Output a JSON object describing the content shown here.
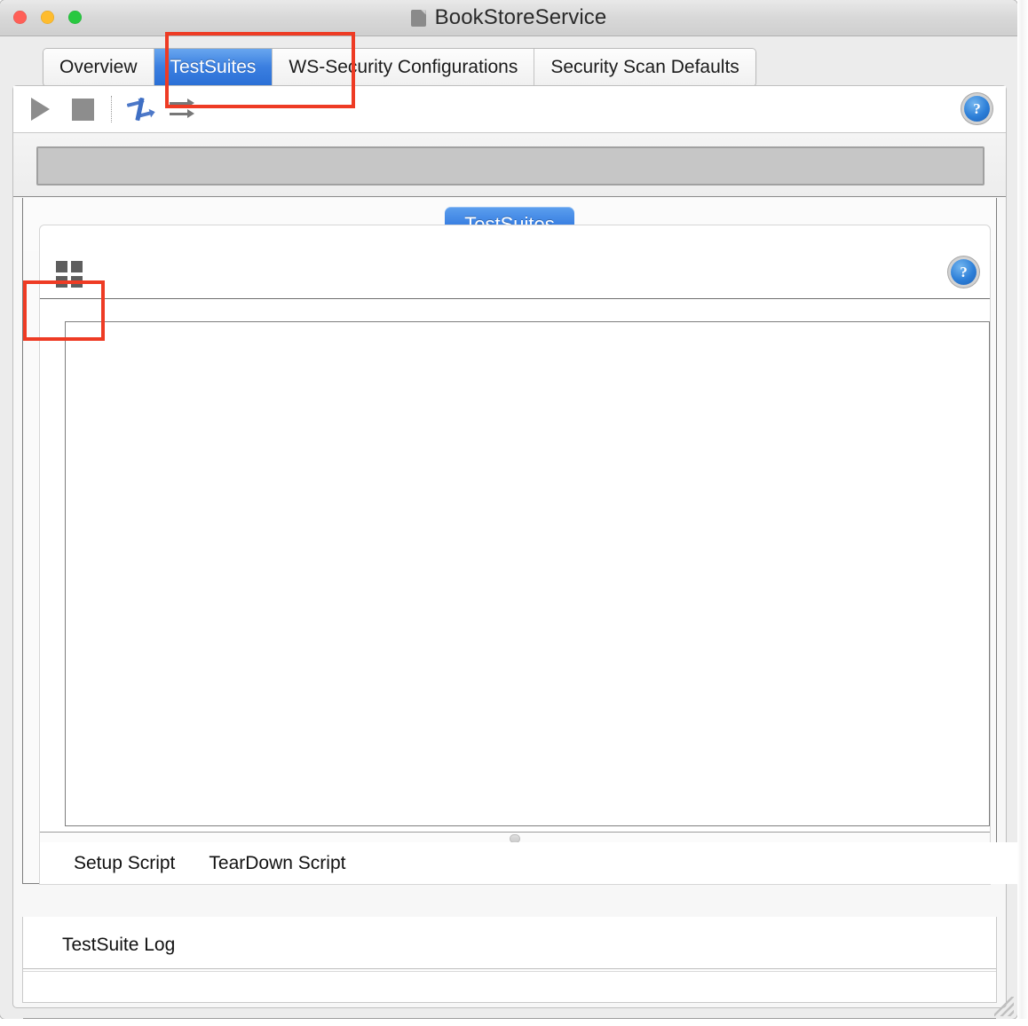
{
  "window": {
    "title": "BookStoreService",
    "title_icon": "document-icon",
    "controls": {
      "close": "close-button",
      "minimize": "minimize-button",
      "zoom": "zoom-button"
    },
    "colors": {
      "close": "#ff5f57",
      "minimize": "#febc2e",
      "zoom": "#28c840",
      "accent_blue": "#2f74da",
      "annotation_red": "#ee3b24"
    }
  },
  "tabs": [
    {
      "label": "Overview",
      "selected": false
    },
    {
      "label": "TestSuites",
      "selected": true
    },
    {
      "label": "WS-Security Configurations",
      "selected": false
    },
    {
      "label": "Security Scan Defaults",
      "selected": false
    }
  ],
  "toolbar": {
    "run_label": "run-button",
    "stop_label": "stop-button",
    "parallel_label": "toggle-parallel-sequential-button",
    "sequence_label": "sequence-arrows-button",
    "help_label": "?"
  },
  "progress": {
    "value": "",
    "percent": 0
  },
  "inner": {
    "pill_tab": "TestSuites",
    "grid_toggle": "grid-view-toggle",
    "help_label": "?",
    "list_items": []
  },
  "script_tabs": [
    {
      "label": "Setup Script"
    },
    {
      "label": "TearDown Script"
    }
  ],
  "log": {
    "title": "TestSuite Log",
    "rows": []
  }
}
